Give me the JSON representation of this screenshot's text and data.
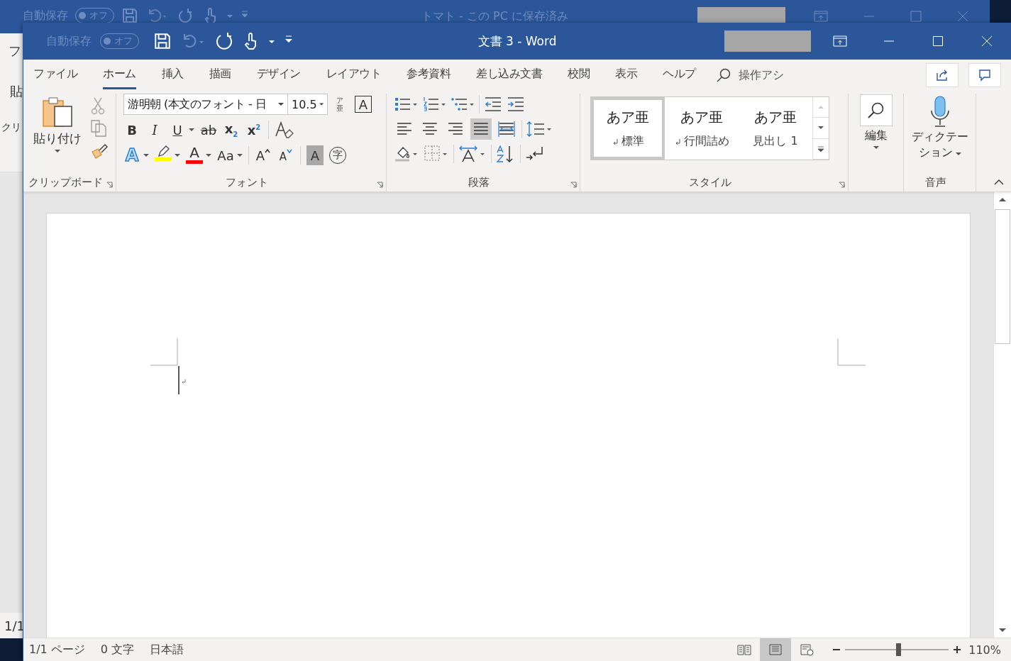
{
  "back_window": {
    "autosave_label": "自動保存",
    "autosave_state": "オフ",
    "autosave_on": false,
    "title": "トマト - この PC に保存済み",
    "tab_fragment": "フ",
    "paste_fragment": "貼",
    "group_fragment": "クリ",
    "status_fragment": "1/1"
  },
  "window": {
    "autosave_label": "自動保存",
    "autosave_state": "オフ",
    "autosave_on": false,
    "title": "文書 3 - Word"
  },
  "tabs": [
    {
      "label": "ファイル",
      "selected": false
    },
    {
      "label": "ホーム",
      "selected": true
    },
    {
      "label": "挿入",
      "selected": false
    },
    {
      "label": "描画",
      "selected": false
    },
    {
      "label": "デザイン",
      "selected": false
    },
    {
      "label": "レイアウト",
      "selected": false
    },
    {
      "label": "参考資料",
      "selected": false
    },
    {
      "label": "差し込み文書",
      "selected": false
    },
    {
      "label": "校閲",
      "selected": false
    },
    {
      "label": "表示",
      "selected": false
    },
    {
      "label": "ヘルプ",
      "selected": false
    }
  ],
  "tell_me": "操作アシ",
  "clipboard": {
    "paste_label": "貼り付け",
    "group_label": "クリップボード"
  },
  "font": {
    "name": "游明朝 (本文のフォント - 日",
    "size": "10.5",
    "phonetic_top": "ア",
    "phonetic_bottom": "亜",
    "border_label": "A",
    "row2": [
      {
        "kind": "bold",
        "label": "B",
        "dropdown": false
      },
      {
        "kind": "italic",
        "label": "I",
        "dropdown": false
      },
      {
        "kind": "underline",
        "label": "U",
        "dropdown": true
      },
      {
        "kind": "strike",
        "label": "ab",
        "dropdown": false
      },
      {
        "kind": "sub",
        "label": "x$_{2}$",
        "dropdown": false
      },
      {
        "kind": "sup",
        "label": "x$^{2}$",
        "dropdown": false
      }
    ],
    "row3": [
      {
        "kind": "effect",
        "label": "A",
        "dropdown": true
      },
      {
        "kind": "highlight",
        "color": "#ffff00",
        "dropdown": true
      },
      {
        "kind": "fontcolor",
        "label": "A",
        "color": "#ff0000",
        "dropdown": true
      },
      {
        "kind": "case",
        "label": "Aa",
        "dropdown": true
      },
      {
        "kind": "grow",
        "label": "A",
        "dropdown": false
      },
      {
        "kind": "shrink",
        "label": "A",
        "dropdown": false
      },
      {
        "kind": "shade",
        "label": "A",
        "dropdown": false
      },
      {
        "kind": "enclose",
        "label": "字",
        "dropdown": false
      }
    ],
    "group_label": "フォント"
  },
  "paragraph": {
    "alignment": [
      {
        "kind": "left",
        "selected": false
      },
      {
        "kind": "center",
        "selected": false
      },
      {
        "kind": "right",
        "selected": false
      },
      {
        "kind": "justify",
        "selected": true
      },
      {
        "kind": "distributed",
        "selected": false
      }
    ],
    "group_label": "段落"
  },
  "styles": {
    "items": [
      {
        "preview": "あア亜",
        "name": "標準",
        "paragraph_mark": true,
        "selected": true
      },
      {
        "preview": "あア亜",
        "name": "行間詰め",
        "paragraph_mark": true,
        "selected": false
      },
      {
        "preview": "あア亜",
        "name": "見出し 1",
        "paragraph_mark": false,
        "selected": false
      }
    ],
    "group_label": "スタイル"
  },
  "editing": {
    "label": "編集"
  },
  "voice": {
    "label": "ディクテーション",
    "group_label": "音声"
  },
  "status_bar": {
    "page": "1/1 ページ",
    "words": "0 文字",
    "language": "日本語",
    "views": [
      {
        "kind": "read",
        "selected": false
      },
      {
        "kind": "print",
        "selected": true
      },
      {
        "kind": "web",
        "selected": false
      }
    ],
    "zoom": {
      "level": 0.51,
      "reading": "110%"
    }
  }
}
